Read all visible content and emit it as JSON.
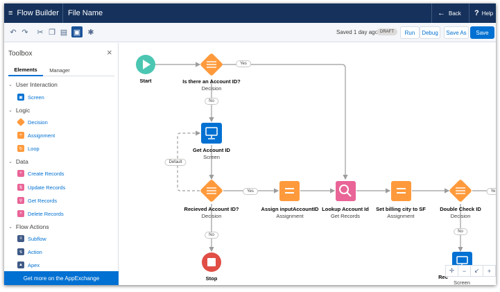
{
  "header": {
    "app_name": "Flow Builder",
    "file_name": "File Name",
    "back_label": "Back",
    "help_label": "Help"
  },
  "toolbar": {
    "status_text": "Saved 1 day ago",
    "draft_badge": "DRAFT",
    "run_label": "Run",
    "debug_label": "Debug",
    "save_as_label": "Save As",
    "save_label": "Save",
    "icons": [
      "undo-icon",
      "redo-icon",
      "cut-icon",
      "copy-icon",
      "paste-icon",
      "toggle-toolbox-icon",
      "settings-icon"
    ]
  },
  "toolbox": {
    "title": "Toolbox",
    "tabs": [
      "Elements",
      "Manager"
    ],
    "active_tab": "Elements",
    "sections": [
      {
        "name": "User Interaction",
        "items": [
          {
            "label": "Screen",
            "color": "#0070d2"
          }
        ]
      },
      {
        "name": "Logic",
        "items": [
          {
            "label": "Decision",
            "color": "#ff9a3c"
          },
          {
            "label": "Assignment",
            "color": "#ff9a3c"
          },
          {
            "label": "Loop",
            "color": "#ff9a3c"
          }
        ]
      },
      {
        "name": "Data",
        "items": [
          {
            "label": "Create Records",
            "color": "#e96497"
          },
          {
            "label": "Update Records",
            "color": "#e96497"
          },
          {
            "label": "Get Records",
            "color": "#e96497"
          },
          {
            "label": "Delete Records",
            "color": "#e96497"
          }
        ]
      },
      {
        "name": "Flow Actions",
        "items": [
          {
            "label": "Subflow",
            "color": "#3f5a86"
          },
          {
            "label": "Action",
            "color": "#3f5a86"
          },
          {
            "label": "Apex",
            "color": "#3f5a86"
          }
        ]
      }
    ],
    "appexchange_label": "Get more on the AppExchange"
  },
  "canvas": {
    "nodes": {
      "start": {
        "title": "Start",
        "subtitle": ""
      },
      "decision1": {
        "title": "Is there an Account ID?",
        "subtitle": "Decision"
      },
      "screen1": {
        "title": "Get Account ID",
        "subtitle": "Screen"
      },
      "decision2": {
        "title": "Recieved Account ID?",
        "subtitle": "Decision"
      },
      "assign1": {
        "title": "Assign inputAccountID",
        "subtitle": "Assignment"
      },
      "lookup": {
        "title": "Lookup Account Id",
        "subtitle": "Get Records"
      },
      "assign2": {
        "title": "Set billing city to SF",
        "subtitle": "Assignment"
      },
      "decision3": {
        "title": "Double Check ID",
        "subtitle": "Decision"
      },
      "stop": {
        "title": "Stop",
        "subtitle": ""
      },
      "screen2": {
        "title": "Rec",
        "subtitle": "Screen"
      }
    },
    "connectors": {
      "yes1": "Yes",
      "no1": "No",
      "default": "Default",
      "yes2": "Yes",
      "no2": "No",
      "no3": "No",
      "yes3": "Ye"
    }
  },
  "zoom_controls": [
    "pan-icon",
    "zoom-out-icon",
    "fit-icon",
    "zoom-in-icon"
  ],
  "colors": {
    "header_bg": "#16325c",
    "brand_blue": "#0070d2",
    "decision_orange": "#ff9a3c",
    "records_pink": "#e96497",
    "start_teal": "#4bc6b2",
    "stop_red": "#e04e45"
  }
}
